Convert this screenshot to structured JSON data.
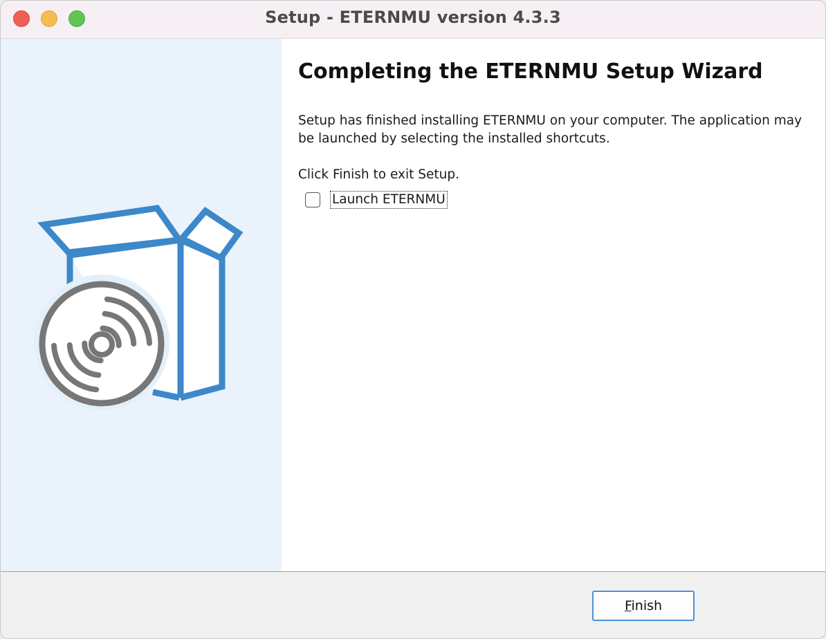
{
  "window": {
    "title": "Setup - ETERNMU version 4.3.3"
  },
  "wizard": {
    "heading": "Completing the ETERNMU Setup Wizard",
    "paragraph": "Setup has finished installing ETERNMU on your computer. The application may be launched by selecting the installed shortcuts.",
    "instruction": "Click Finish to exit Setup.",
    "launch_checkbox": {
      "label": "Launch ETERNMU",
      "checked": false
    }
  },
  "footer": {
    "finish_mnemonic": "F",
    "finish_rest": "inish"
  },
  "icons": {
    "close": "close-icon",
    "minimize": "minimize-icon",
    "zoom": "zoom-icon",
    "illustration": "software-box-with-disc-icon"
  },
  "colors": {
    "accent_blue": "#3c88c9",
    "panel_bg": "#eaf3fb",
    "disc_gray": "#777777"
  }
}
